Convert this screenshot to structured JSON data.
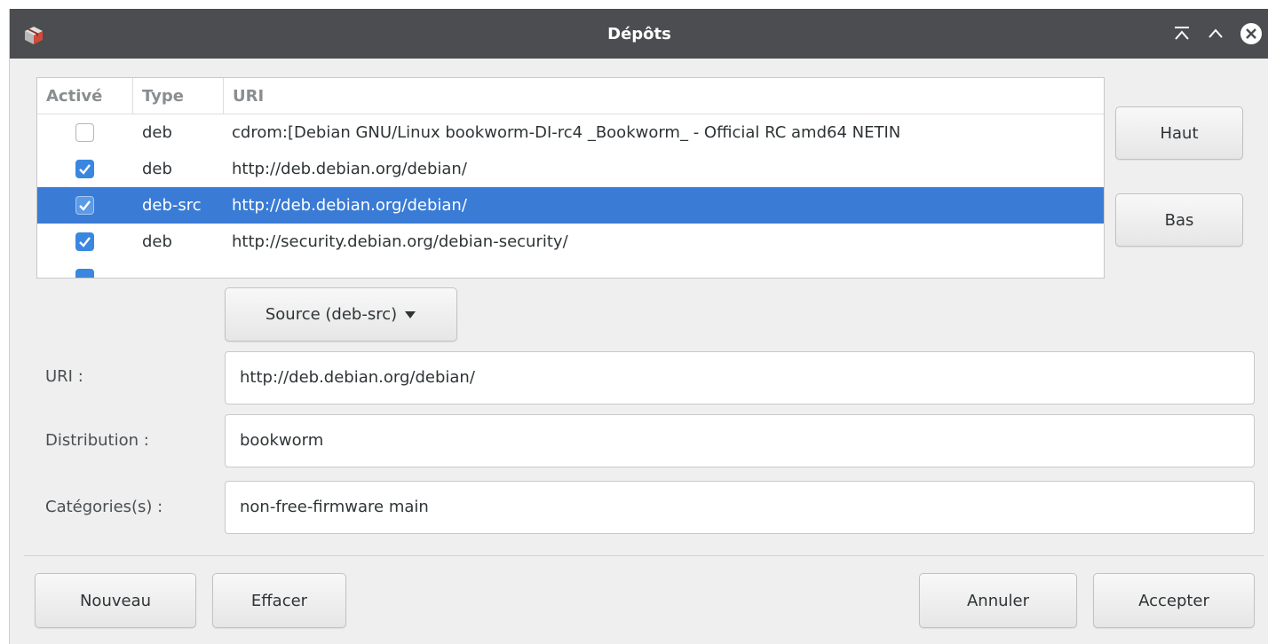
{
  "window": {
    "title": "Dépôts"
  },
  "colors": {
    "titlebar": "#4b4d50",
    "selection": "#3a7bd5",
    "checkbox_checked": "#3a87e0",
    "dialog_background": "#efefef"
  },
  "titlebar_icons": {
    "app": "package-icon",
    "minimize": "minimize-icon",
    "maximize": "maximize-icon",
    "close": "close-icon"
  },
  "list": {
    "columns": [
      "Activé",
      "Type",
      "URI"
    ],
    "rows": [
      {
        "enabled": false,
        "type": "deb",
        "uri": "cdrom:[Debian GNU/Linux bookworm-DI-rc4 _Bookworm_ - Official RC amd64 NETIN",
        "selected": false
      },
      {
        "enabled": true,
        "type": "deb",
        "uri": "http://deb.debian.org/debian/",
        "selected": false
      },
      {
        "enabled": true,
        "type": "deb-src",
        "uri": "http://deb.debian.org/debian/",
        "selected": true
      },
      {
        "enabled": true,
        "type": "deb",
        "uri": "http://security.debian.org/debian-security/",
        "selected": false
      }
    ]
  },
  "side_buttons": {
    "up": "Haut",
    "down": "Bas"
  },
  "source_dropdown": {
    "label": "Source (deb-src)",
    "icon": "triangle-down-icon"
  },
  "form": {
    "uri_label": "URI :",
    "uri_value": "http://deb.debian.org/debian/",
    "distribution_label": "Distribution :",
    "distribution_value": "bookworm",
    "categories_label": "Catégories(s) :",
    "categories_value": "non-free-firmware main"
  },
  "footer": {
    "new": "Nouveau",
    "erase": "Effacer",
    "cancel": "Annuler",
    "accept": "Accepter"
  }
}
